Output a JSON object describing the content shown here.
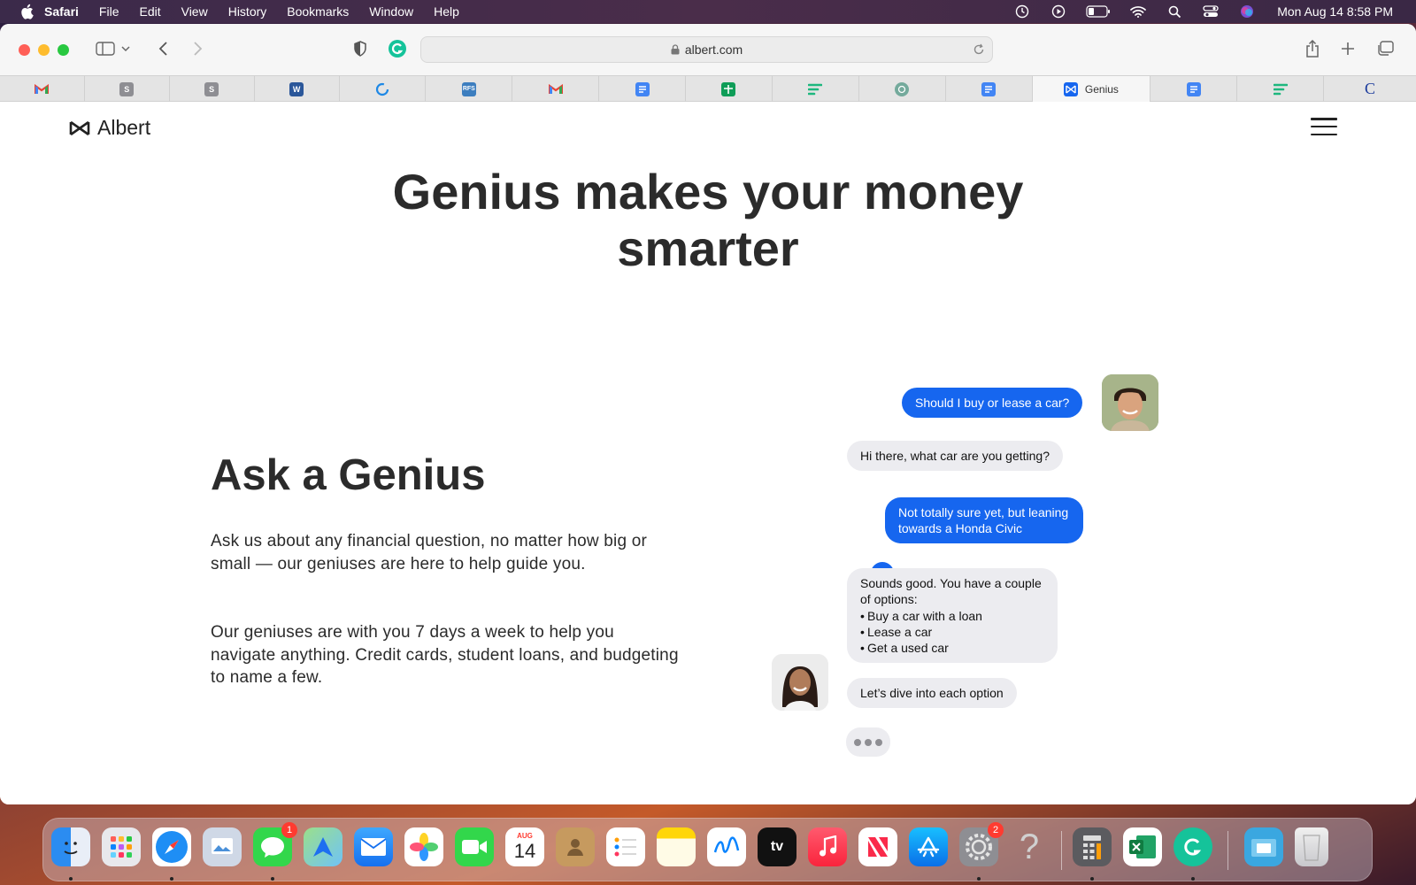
{
  "menubar": {
    "app_name": "Safari",
    "items": [
      "File",
      "Edit",
      "View",
      "History",
      "Bookmarks",
      "Window",
      "Help"
    ],
    "status_icons": [
      "time-machine-icon",
      "play-icon",
      "battery-icon",
      "wifi-icon",
      "spotlight-icon",
      "control-center-icon",
      "siri-icon"
    ],
    "clock": "Mon Aug 14  8:58 PM"
  },
  "toolbar": {
    "url": "albert.com"
  },
  "tabs": [
    {
      "icon": "gmail-icon",
      "label": ""
    },
    {
      "icon": "s-app-icon",
      "label": ""
    },
    {
      "icon": "s-app-icon",
      "label": ""
    },
    {
      "icon": "word-icon",
      "label": ""
    },
    {
      "icon": "refresh-icon",
      "label": ""
    },
    {
      "icon": "rfs-icon",
      "label": ""
    },
    {
      "icon": "gmail-icon",
      "label": ""
    },
    {
      "icon": "google-docs-icon",
      "label": ""
    },
    {
      "icon": "google-sheets-icon",
      "label": ""
    },
    {
      "icon": "bars-icon",
      "label": ""
    },
    {
      "icon": "openai-icon",
      "label": ""
    },
    {
      "icon": "google-docs-icon",
      "label": ""
    },
    {
      "icon": "albert-icon",
      "label": "Genius",
      "active": true
    },
    {
      "icon": "google-docs-icon",
      "label": ""
    },
    {
      "icon": "bars-icon",
      "label": ""
    },
    {
      "icon": "c-icon",
      "label": ""
    }
  ],
  "page": {
    "logo_text": "Albert",
    "hero_title_line1": "Genius makes your money",
    "hero_title_line2": "smarter",
    "section_title": "Ask a Genius",
    "paragraph1": "Ask us about any financial question, no matter how big or small — our geniuses are here to help guide you.",
    "paragraph2": "Our geniuses are with you 7 days a week to help you navigate anything. Credit cards, student loans, and budgeting to name a few."
  },
  "chat": {
    "msg1": "Should I buy or lease a car?",
    "msg2": "Hi there, what car are you getting?",
    "msg3": "Not totally sure yet, but leaning towards a Honda Civic",
    "msg4_intro": "Sounds good. You have a couple of options:",
    "msg4_options": [
      "Buy a car with a loan",
      "Lease a car",
      "Get a used car"
    ],
    "msg5": "Let’s dive into each option"
  },
  "dock": {
    "apps": [
      "Finder",
      "Launchpad",
      "Safari",
      "Preview",
      "Messages",
      "Maps",
      "Mail",
      "Photos",
      "FaceTime",
      "Calendar",
      "Contacts",
      "Reminders",
      "Notes",
      "Freeform",
      "TV",
      "Music",
      "News",
      "App Store",
      "System Settings",
      "Help",
      "Calculator",
      "Excel",
      "Grammarly",
      "Screenshots",
      "Trash"
    ],
    "messages_badge": "1",
    "settings_badge": "2",
    "calendar_month": "AUG",
    "calendar_day": "14",
    "tv_label": "tv"
  },
  "colors": {
    "accent_blue": "#1666ef",
    "bubble_gray": "#ececf0",
    "text_dark": "#2b2b2b"
  }
}
